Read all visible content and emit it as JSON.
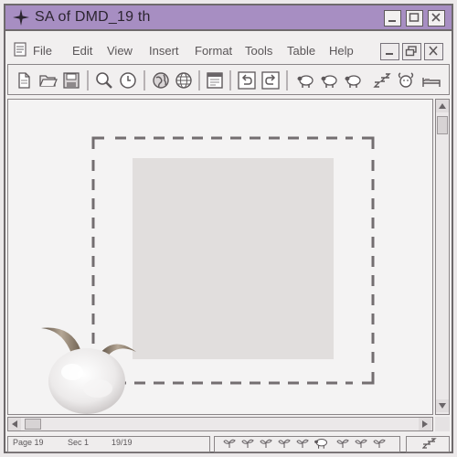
{
  "window": {
    "title": "SA of DMD_19 th"
  },
  "menu": {
    "items": [
      {
        "label": "File"
      },
      {
        "label": "Edit"
      },
      {
        "label": "View"
      },
      {
        "label": "Insert"
      },
      {
        "label": "Format"
      },
      {
        "label": "Tools"
      },
      {
        "label": "Table"
      },
      {
        "label": "Help"
      }
    ]
  },
  "toolbar": {
    "icons": [
      "new-document-icon",
      "open-folder-icon",
      "save-icon",
      "search-icon",
      "clock-icon",
      "globe-icon",
      "grid-globe-icon",
      "window-icon",
      "undo-icon",
      "redo-icon",
      "sheep-icon",
      "sheep-icon",
      "sheep-icon",
      "sleep-zzz-icon",
      "sheep-face-icon",
      "bed-icon"
    ]
  },
  "status": {
    "page": "Page 19",
    "section": "Sec 1",
    "count": "19/19",
    "icons": [
      "sprout-icon",
      "sprout-icon",
      "sprout-icon",
      "sprout-icon",
      "sprout-icon",
      "sheep-icon",
      "sprout-icon",
      "sprout-icon",
      "sprout-icon",
      "sleep-zzz-icon"
    ]
  },
  "colors": {
    "titlebar": "#a78ec2",
    "frame": "#6f6a6c",
    "placeholder": "#e1dedd"
  }
}
